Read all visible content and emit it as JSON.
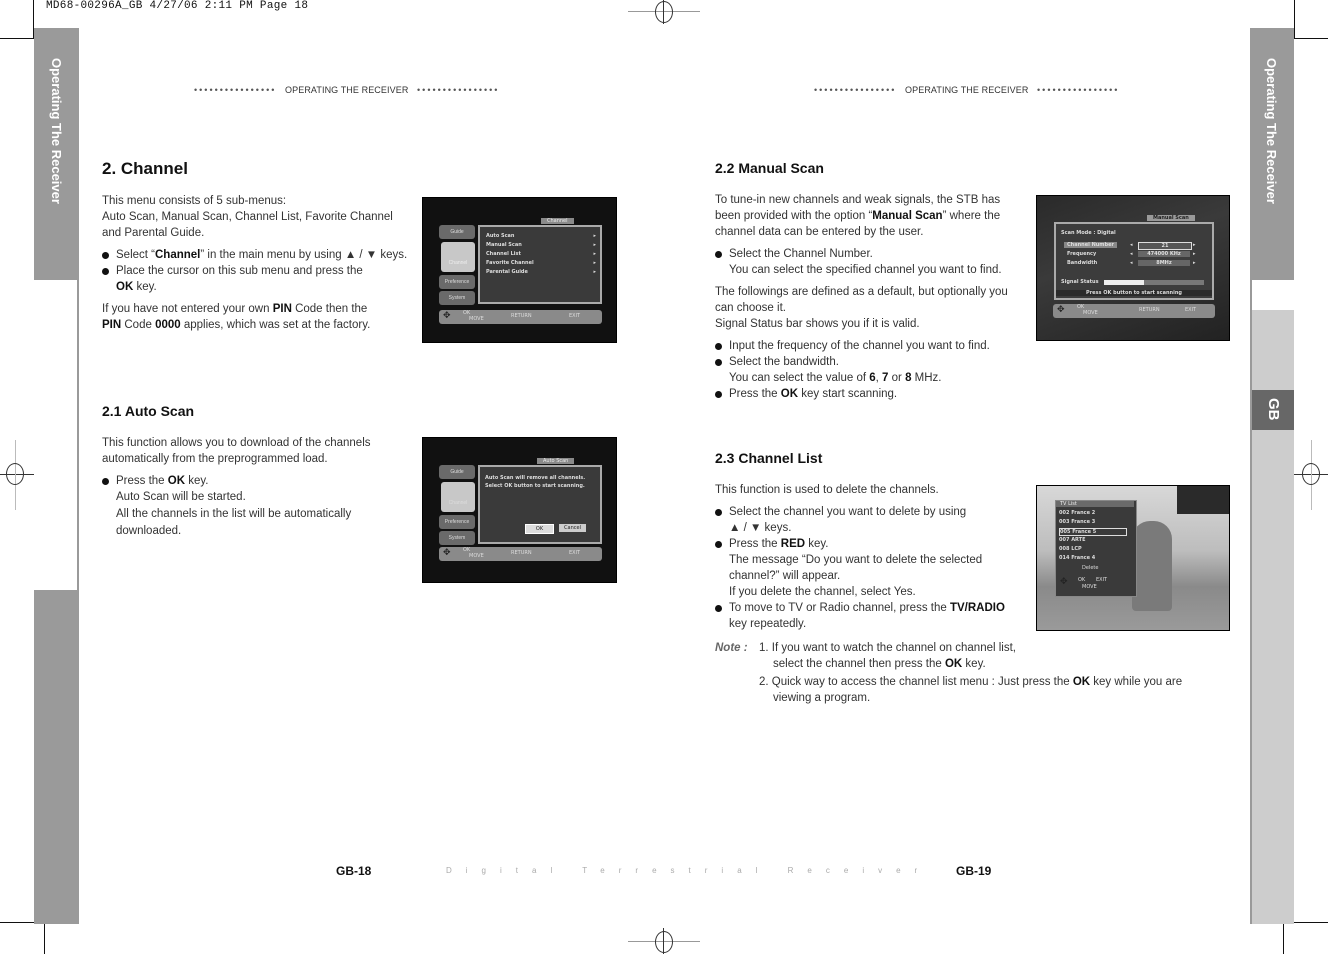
{
  "slug": "MD68-00296A_GB  4/27/06  2:11 PM  Page 18",
  "side_tab_text": "Operating The Receiver",
  "lang_tab": "GB",
  "running_head": {
    "dots": "••••••••••••••••",
    "title": "OPERATING THE RECEIVER"
  },
  "left_page": {
    "section": {
      "heading": "2. Channel",
      "intro1": "This menu consists of 5 sub-menus:",
      "intro2": "Auto Scan, Manual Scan, Channel List, Favorite Channel",
      "intro3": "and Parental Guide.",
      "bullet1_pre": "Select “",
      "bullet1_bold": "Channel",
      "bullet1_post": "” in the main menu by using ▲ / ▼ keys.",
      "bullet2_l1": "Place the cursor on this sub menu and press the",
      "bullet2_bold": "OK",
      "bullet2_post": " key.",
      "pin_l1_pre": "If you have not entered your own ",
      "pin_l1_bold": "PIN",
      "pin_l1_post": " Code then the",
      "pin_l2_bold1": "PIN",
      "pin_l2_mid": " Code ",
      "pin_l2_bold2": "0000",
      "pin_l2_post": " applies, which was set at the factory."
    },
    "auto_scan": {
      "heading": "2.1 Auto Scan",
      "p1": "This function allows you to download of the channels",
      "p2": "automatically from the preprogrammed load.",
      "bullet_pre": "Press the ",
      "bullet_bold": "OK",
      "bullet_post": " key.",
      "line2": "Auto Scan will be started.",
      "line3": "All the channels in the list will be automatically",
      "line4": "downloaded."
    },
    "page_number": "GB-18"
  },
  "right_page": {
    "manual_scan": {
      "heading": "2.2 Manual Scan",
      "p1": "To tune-in new channels and weak signals, the STB has",
      "p2_pre": "been provided with the option “",
      "p2_bold": "Manual Scan",
      "p2_post": "” where the",
      "p3": "channel data can be entered by the user.",
      "b1_l1": "Select the Channel Number.",
      "b1_l2": "You can select the specified channel you want to find.",
      "p4": "The followings are defined as a default, but optionally you",
      "p5": "can choose it.",
      "p6": "Signal Status bar shows you if it is valid.",
      "b2": "Input the frequency of the channel you want to find.",
      "b3_l1": "Select the bandwidth.",
      "b3_l2_pre": "You can select the value of ",
      "b3_6": "6",
      "b3_comma": ", ",
      "b3_7": "7",
      "b3_or": " or ",
      "b3_8": "8",
      "b3_post": " MHz.",
      "b4_pre": "Press the ",
      "b4_bold": "OK",
      "b4_post": " key start scanning."
    },
    "channel_list": {
      "heading": "2.3 Channel List",
      "p1": "This function is used to delete the channels.",
      "b1_l1": "Select the channel you want to delete by using",
      "b1_l2": "▲ / ▼ keys.",
      "b2_pre": "Press the ",
      "b2_bold": "RED",
      "b2_post": " key.",
      "b2_l2": "The message “Do you want to delete the selected",
      "b2_l3": "channel?” will appear.",
      "b2_l4": "If you delete the channel, select Yes.",
      "b3_pre": "To move to TV or Radio channel, press the ",
      "b3_bold": "TV/RADIO",
      "b3_l2": "key repeatedly."
    },
    "note": {
      "label": "Note :",
      "n1_l1": "1. If you want to watch the channel on channel list,",
      "n1_l2_pre": "select the channel then press the ",
      "n1_l2_bold": "OK",
      "n1_l2_post": " key.",
      "n2_l1_pre": "2. Quick way to access the channel list menu : Just press the ",
      "n2_l1_bold": "OK",
      "n2_l1_post": " key while you are",
      "n2_l2": "viewing a program."
    },
    "page_number": "GB-19"
  },
  "footer_center": "Digital Terrestrial Receiver",
  "osd_common": {
    "tabs": [
      "Guide",
      "Channel",
      "Preference",
      "System"
    ],
    "ok": "OK",
    "move": "MOVE",
    "return": "RETURN",
    "exit": "EXIT"
  },
  "osd_channel": {
    "title": "Channel",
    "items": [
      "Auto Scan",
      "Manual Scan",
      "Channel List",
      "Favorite Channel",
      "Parental Guide"
    ]
  },
  "osd_autoscan": {
    "title": "Auto Scan",
    "msg1": "Auto Scan will remove all channels.",
    "msg2": "Select OK button to start scanning.",
    "ok_btn": "OK",
    "cancel_btn": "Cancel"
  },
  "osd_manual": {
    "title": "Manual Scan",
    "mode": "Scan Mode : Digital",
    "fields": [
      {
        "label": "Channel Number",
        "value": "21"
      },
      {
        "label": "Frequency",
        "value": "474000 KHz"
      },
      {
        "label": "Bandwidth",
        "value": "8MHz"
      }
    ],
    "signal_label": "Signal Status",
    "signal_level": 0.4,
    "hint": "Press OK button to start scanning"
  },
  "osd_tvlist": {
    "title": "TV List",
    "rows": [
      {
        "num": "002",
        "name": "France 2"
      },
      {
        "num": "003",
        "name": "France 3"
      },
      {
        "num": "005",
        "name": "France 5"
      },
      {
        "num": "007",
        "name": "ARTE"
      },
      {
        "num": "008",
        "name": "LCP"
      },
      {
        "num": "014",
        "name": "France 4"
      }
    ],
    "selected_index": 2,
    "delete": "Delete",
    "ok": "OK",
    "exit": "EXIT",
    "move": "MOVE"
  }
}
